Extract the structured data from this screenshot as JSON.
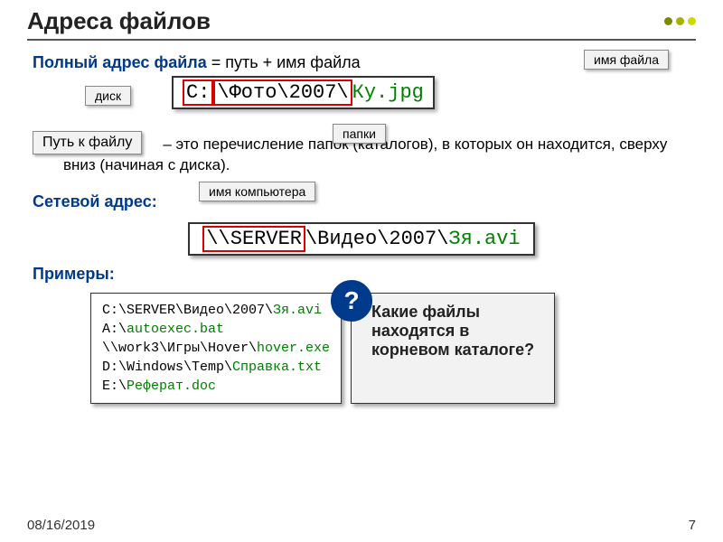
{
  "title": "Адреса файлов",
  "line1": {
    "term": "Полный адрес файла",
    "rest": " = путь + имя файла"
  },
  "tags": {
    "filename": "имя файла",
    "disk": "диск",
    "folders": "папки",
    "path_term": "Путь к файлу",
    "computer_name": "имя компьютера"
  },
  "path1": {
    "drive": "C:",
    "folders_text": "\\Фото\\2007\\",
    "file": "Ку.jpg"
  },
  "path_desc": " – это перечисление папок (каталогов), в которых он находится, сверху вниз (начиная с диска).",
  "net_label": "Сетевой адрес:",
  "net_path": {
    "server": "\\\\SERVER",
    "folders": "\\Видео\\2007\\",
    "file": "Зя.avi"
  },
  "examples_label": "Примеры:",
  "examples": {
    "l1a": "C:\\SERVER\\Видео\\2007\\",
    "l1b": "Зя.avi",
    "l2a": "A:\\",
    "l2b": "autoexec.bat",
    "l3a": "\\\\work3\\Игры\\Hover\\",
    "l3b": "hover.exe",
    "l4a": "D:\\Windows\\Temp\\",
    "l4b": "Справка.txt",
    "l5a": "E:\\",
    "l5b": "Реферат.doc"
  },
  "question_mark": "?",
  "question": "Какие файлы находятся в корневом каталоге?",
  "footer_date": "08/16/2019",
  "footer_page": "7"
}
